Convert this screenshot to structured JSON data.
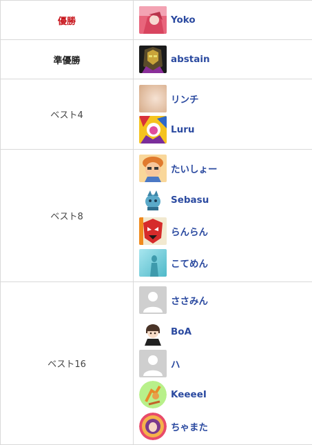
{
  "groups": [
    {
      "rank": "優勝",
      "players": [
        {
          "name": "Yoko",
          "avatar": "pink-anime-avatar"
        }
      ]
    },
    {
      "rank": "準優勝",
      "players": [
        {
          "name": "abstain",
          "avatar": "dark-helmet-avatar"
        }
      ]
    },
    {
      "rank": "ベスト4",
      "players": [
        {
          "name": "リンチ",
          "avatar": "blurred-beige-avatar"
        },
        {
          "name": "Luru",
          "avatar": "colorful-anime-avatar"
        }
      ]
    },
    {
      "rank": "ベスト8",
      "players": [
        {
          "name": "たいしょー",
          "avatar": "cartoon-character-avatar"
        },
        {
          "name": "Sebasu",
          "avatar": "blue-pixel-creature-avatar"
        },
        {
          "name": "らんらん",
          "avatar": "red-mask-avatar"
        },
        {
          "name": "こてめん",
          "avatar": "teal-silhouette-avatar"
        }
      ]
    },
    {
      "rank": "ベスト16",
      "players": [
        {
          "name": "ささみん",
          "avatar": "default-user-avatar"
        },
        {
          "name": "BoA",
          "avatar": "chibi-boy-avatar"
        },
        {
          "name": "ハ",
          "avatar": "default-user-avatar"
        },
        {
          "name": "KeeeeI",
          "avatar": "green-sprite-avatar"
        },
        {
          "name": "ちゃまた",
          "avatar": "round-pink-portrait-avatar"
        }
      ]
    }
  ],
  "colors": {
    "winner_label": "#c8161d",
    "player_name": "#2b4aa0",
    "border": "#d9d9d9"
  }
}
